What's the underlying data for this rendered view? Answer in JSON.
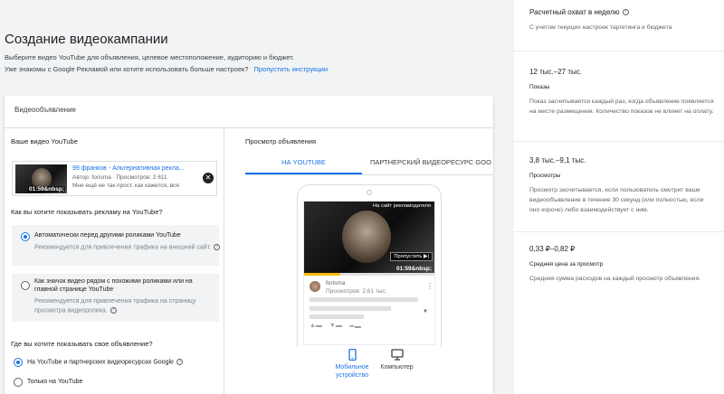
{
  "page": {
    "title": "Создание видеокампании",
    "subtitle": "Выберите видео YouTube для объявления, целевое местоположение, аудиторию и бюджет.",
    "subtitle2": "Уже знакомы с Google Рекламой или хотите использовать больше настроек?",
    "skip_link": "Пропустить инструкции"
  },
  "card": {
    "header": "Видеообъявление",
    "your_video_label": "Ваше видео YouTube",
    "video": {
      "duration": "01:59&nbsp;",
      "title": "99 франков - Альтернативная рекла...",
      "meta1": "Автор: forisma · Просмотров: 2 611",
      "meta2": "Мне ещё не так прост, как кажется, вся"
    },
    "how_question": "Как вы хотите показывать рекламу на YouTube?",
    "options": [
      {
        "title": "Автоматически перед другими роликами YouTube",
        "desc1": "Рекомендуется для привлечения трафика на внешний сайт.",
        "selected": true
      },
      {
        "title": "Как значок видео рядом с похожими роликами или на",
        "title2": "главной странице YouTube",
        "desc1": "Рекомендуется для привлечения трафика на страницу",
        "desc2": "просмотра видеоролика.",
        "selected": false
      }
    ],
    "where_question": "Где вы хотите показывать свое объявление?",
    "where_options": [
      {
        "label": "На YouTube и партнерских видеоресурсах Google",
        "selected": true
      },
      {
        "label": "Только на YouTube",
        "selected": false
      }
    ]
  },
  "preview": {
    "label": "Просмотр объявления",
    "tabs": [
      "НА YOUTUBE",
      "ПАРТНЕРСКИЙ ВИДЕОРЕСУРС GOO"
    ],
    "active_tab": 0,
    "advertiser_site": "На сайт рекламодателя",
    "skip_ad": "Пропустить ▶|",
    "duration": "01:59&nbsp;",
    "progress": 0.28,
    "channel": "forisma",
    "views": "Просмотров: 2,61 тыс.",
    "devices": [
      {
        "icon": "smartphone-icon",
        "label": "Мобильное",
        "label2": "устройство",
        "active": true
      },
      {
        "icon": "desktop-icon",
        "label": "Компьютер",
        "label2": "",
        "active": false
      }
    ]
  },
  "sidebar": {
    "title": "Расчетный охват в неделю",
    "subtitle": "С учетом текущих настроек таргетинга и бюджета",
    "stats": [
      {
        "value": "12 тыс.–27 тыс.",
        "label": "Показы",
        "desc": "Показ засчитывается каждый раз, когда объявление появляется на месте размещения. Количество показов не влияет на оплату."
      },
      {
        "value": "3,8 тыс.–9,1 тыс.",
        "label": "Просмотры",
        "desc": "Просмотр засчитывается, если пользователь смотрит ваше видеообъявление в течение 30 секунд (или полностью, если оно короче) либо взаимодействует с ним."
      },
      {
        "value": "0,33 ₽–0,82 ₽",
        "label": "Средняя цена за просмотр",
        "desc": "Средняя сумма расходов на каждый просмотр объявления."
      }
    ]
  },
  "colors": {
    "accent": "#1a73e8",
    "progress": "#fbbc04",
    "background": "#f1f3f4"
  }
}
